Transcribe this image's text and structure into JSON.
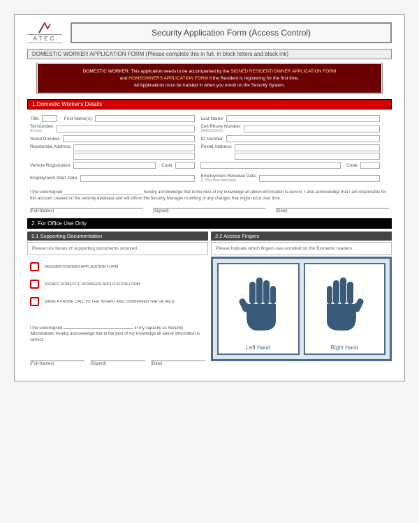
{
  "logo": {
    "text": "ATEC"
  },
  "title": "Security Application Form (Access Control)",
  "topbar": "DOMESTIC WORKER APPLICATION FORM (Please complete this in full, in block letters and black ink)",
  "notice": {
    "l1a": "DOMESTIC WORKER: This application needs to be accompanied by the ",
    "l1b": "SIGNED RESIDENT/OWNER APPLICATION FORM",
    "l2a": "and ",
    "l2b": "HOMEOWNERS APPLICATION FORM",
    "l2c": " if the Resident is registering for the first time.",
    "l3": "All Applications must be handed in when you enroll on the Security System."
  },
  "sec1": "1.Domestic Worker's Details",
  "labels": {
    "title": "Title:",
    "first": "First Name(s):",
    "last": "Last Name:",
    "tel": "Tel Number:",
    "tel_sub": "(Home)",
    "cell": "Cell Phone Number:",
    "cell_sub": "(06XXXXXXX)",
    "stand": "Stand Number:",
    "id": "ID Number:",
    "resaddr": "Residential Address:",
    "postal": "Postal Address:",
    "vehicle": "Vehicle Registration:",
    "code": "Code:",
    "emp_start": "Employment Start Date:",
    "emp_renew": "Employment Renewal Date:",
    "emp_renew_sub": "(1 Year from start date)"
  },
  "ack1": "I the undersigned __________________________________ hereby acknowledge that to the best of my knowledge all above information is correct. I also acknowledge that I am responsible for this account created on the security database and will inform the Security Manager in writing of any changes that might occur over time.",
  "sig": {
    "full": "(Full Names)",
    "signed": "(Signed)",
    "date": "(Date)"
  },
  "sec2": "2. For Office Use Only",
  "sec21": "2.1 Supporting Documentation",
  "sec22": "2.2 Access Fingers",
  "instr21": "Please tick boxes of supporting documents received.",
  "instr22": "Please Indicate which fingers was enrolled on the Biometric readers.",
  "checks": {
    "c1": "RESIDENT/OWNER APPLICATION FORM",
    "c2": "SIGNED DOMESTIC WORKERS APPLICATION FORM",
    "c3": "MADE A PHONE CALL TO THE TENANT AND CONFIRMED THE DETAILS"
  },
  "ack2a": "I the undersigned ",
  "ack2b": " in my capacity as Security Administrator hereby acknowledge that to the best of my knowledge all above information is correct.",
  "hands": {
    "left": "Left Hand",
    "right": "Right Hand"
  }
}
